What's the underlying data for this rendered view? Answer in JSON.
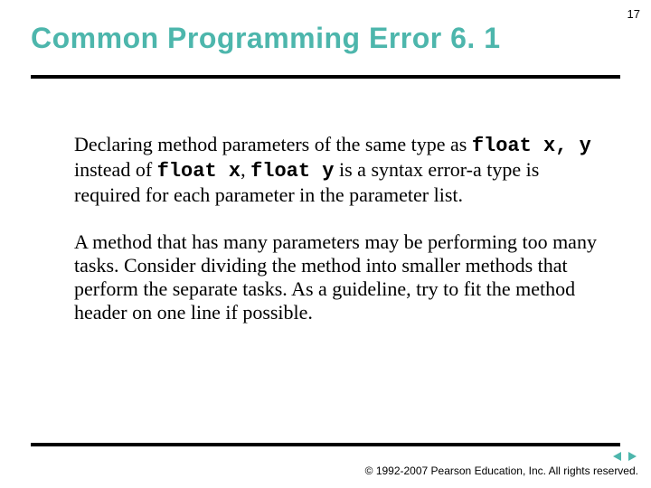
{
  "page_number": "17",
  "title": "Common Programming Error 6. 1",
  "body": {
    "p1_a": "Declaring method parameters of the same type as ",
    "p1_code1": "float x, y",
    "p1_b": " instead of ",
    "p1_code2": "float x",
    "p1_c": ", ",
    "p1_code3": "float y",
    "p1_d": " is a syntax error-a type is required for each parameter in the parameter list.",
    "p2": "A method that has many parameters may be performing too many tasks. Consider dividing the method into smaller methods that perform the separate tasks. As a guideline, try to fit the method header on one line if possible."
  },
  "copyright": "© 1992-2007 Pearson Education, Inc.  All rights reserved.",
  "colors": {
    "title": "#4db6ac",
    "nav_arrow": "#4db6ac"
  }
}
